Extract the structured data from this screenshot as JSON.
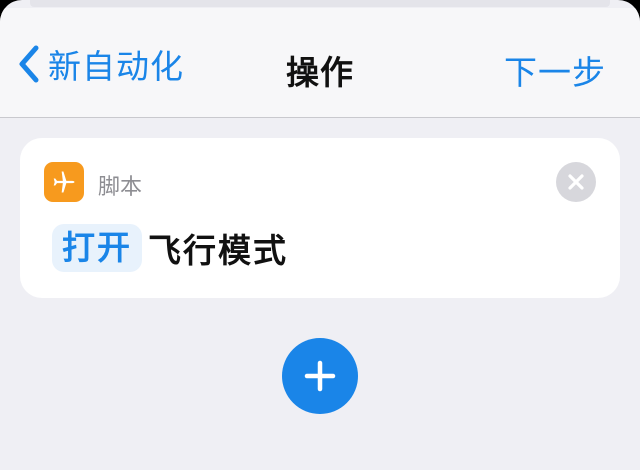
{
  "nav": {
    "back_label": "新自动化",
    "title": "操作",
    "next_label": "下一步"
  },
  "action_card": {
    "app_icon": "airplane-icon",
    "category": "脚本",
    "verb": "打开",
    "target": "飞行模式"
  },
  "icons": {
    "back": "chevron-left-icon",
    "remove": "close-icon",
    "add": "plus-icon"
  },
  "colors": {
    "accent": "#1a85e8",
    "app_icon_bg": "#f79a1e",
    "background": "#efeff4"
  }
}
